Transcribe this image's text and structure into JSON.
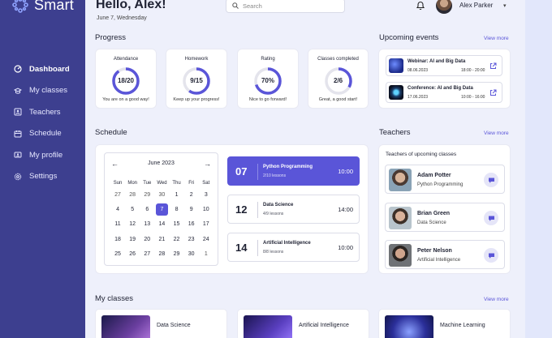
{
  "app": {
    "name": "Smart"
  },
  "nav": {
    "items": [
      {
        "label": "Dashboard",
        "icon": "dashboard-icon",
        "active": true
      },
      {
        "label": "My classes",
        "icon": "classes-icon",
        "active": false
      },
      {
        "label": "Teachers",
        "icon": "teachers-icon",
        "active": false
      },
      {
        "label": "Schedule",
        "icon": "calendar-icon",
        "active": false
      },
      {
        "label": "My profile",
        "icon": "profile-icon",
        "active": false
      },
      {
        "label": "Settings",
        "icon": "gear-icon",
        "active": false
      }
    ]
  },
  "header": {
    "greeting": "Hello, Alex!",
    "date": "June 7, Wednesday",
    "search_placeholder": "Search",
    "user_name": "Alex Parker"
  },
  "progress": {
    "title": "Progress",
    "stats": [
      {
        "title": "Attendance",
        "value": "18/20",
        "fraction": 0.9,
        "caption": "You are on a good way!"
      },
      {
        "title": "Homework",
        "value": "9/15",
        "fraction": 0.6,
        "caption": "Keep up your progress!"
      },
      {
        "title": "Rating",
        "value": "70%",
        "fraction": 0.7,
        "caption": "Nice to go forward!"
      },
      {
        "title": "Classes completed",
        "value": "2/6",
        "fraction": 0.33,
        "caption": "Great, a good start!"
      }
    ]
  },
  "events": {
    "title": "Upcoming events",
    "view_more": "View more",
    "items": [
      {
        "title": "Webinar: AI and Big Data",
        "date": "08.06.2023",
        "time": "18:00 - 20:00"
      },
      {
        "title": "Conference: AI and Big Data",
        "date": "17.06.2023",
        "time": "10:00 - 16:00"
      }
    ]
  },
  "schedule": {
    "title": "Schedule",
    "calendar": {
      "month": "June 2023",
      "weekdays": [
        "Sun",
        "Mon",
        "Tue",
        "Wed",
        "Thu",
        "Fri",
        "Sat"
      ],
      "days": [
        {
          "d": "27",
          "m": true
        },
        {
          "d": "28",
          "m": true
        },
        {
          "d": "29",
          "m": true
        },
        {
          "d": "30",
          "m": true
        },
        {
          "d": "1"
        },
        {
          "d": "2"
        },
        {
          "d": "3"
        },
        {
          "d": "4"
        },
        {
          "d": "5"
        },
        {
          "d": "6"
        },
        {
          "d": "7",
          "today": true
        },
        {
          "d": "8"
        },
        {
          "d": "9"
        },
        {
          "d": "10"
        },
        {
          "d": "11"
        },
        {
          "d": "12"
        },
        {
          "d": "13"
        },
        {
          "d": "14"
        },
        {
          "d": "15"
        },
        {
          "d": "16"
        },
        {
          "d": "17"
        },
        {
          "d": "18"
        },
        {
          "d": "19"
        },
        {
          "d": "20"
        },
        {
          "d": "21"
        },
        {
          "d": "22"
        },
        {
          "d": "23"
        },
        {
          "d": "24"
        },
        {
          "d": "25"
        },
        {
          "d": "26"
        },
        {
          "d": "27"
        },
        {
          "d": "28"
        },
        {
          "d": "29"
        },
        {
          "d": "30"
        },
        {
          "d": "1",
          "m": true
        }
      ]
    },
    "lessons": [
      {
        "day": "07",
        "name": "Python Programming",
        "count": "2/10 lessons",
        "time": "10:00",
        "active": true
      },
      {
        "day": "12",
        "name": "Data Science",
        "count": "4/9 lessons",
        "time": "14:00",
        "active": false
      },
      {
        "day": "14",
        "name": "Artificial Intelligence",
        "count": "8/8 lessons",
        "time": "10:00",
        "active": false
      }
    ]
  },
  "teachers": {
    "title": "Teachers",
    "view_more": "View more",
    "subtitle": "Teachers of upcoming classes",
    "items": [
      {
        "name": "Adam Potter",
        "subject": "Python Programming"
      },
      {
        "name": "Brian Green",
        "subject": "Data Science"
      },
      {
        "name": "Peter Nelson",
        "subject": "Artificial Intelligence"
      }
    ]
  },
  "classes": {
    "title": "My classes",
    "view_more": "View more",
    "items": [
      {
        "name": "Data Science"
      },
      {
        "name": "Artificial Intelligence"
      },
      {
        "name": "Machine Learning"
      }
    ]
  },
  "colors": {
    "sidebar": "#3d3f8f",
    "accent": "#5a55d8",
    "background": "#eef0fb"
  }
}
